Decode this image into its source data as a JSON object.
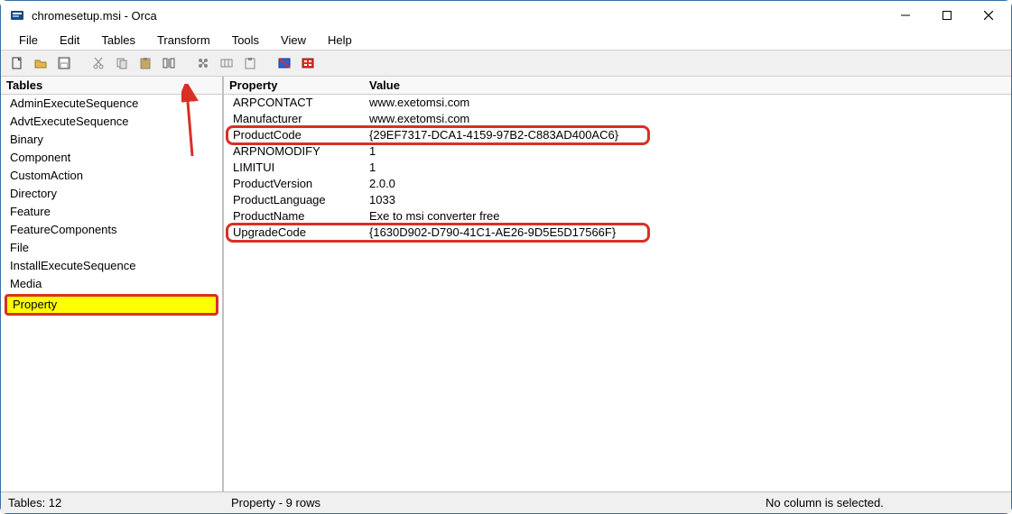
{
  "window": {
    "title": "chromesetup.msi - Orca"
  },
  "menu": {
    "items": [
      "File",
      "Edit",
      "Tables",
      "Transform",
      "Tools",
      "View",
      "Help"
    ]
  },
  "left": {
    "header": "Tables",
    "items": [
      "AdminExecuteSequence",
      "AdvtExecuteSequence",
      "Binary",
      "Component",
      "CustomAction",
      "Directory",
      "Feature",
      "FeatureComponents",
      "File",
      "InstallExecuteSequence",
      "Media",
      "Property"
    ],
    "selected": "Property"
  },
  "grid": {
    "columns": {
      "property": "Property",
      "value": "Value"
    },
    "rows": [
      {
        "property": "ARPCONTACT",
        "value": "www.exetomsi.com"
      },
      {
        "property": "Manufacturer",
        "value": "www.exetomsi.com"
      },
      {
        "property": "ProductCode",
        "value": "{29EF7317-DCA1-4159-97B2-C883AD400AC6}"
      },
      {
        "property": "ARPNOMODIFY",
        "value": "1"
      },
      {
        "property": "LIMITUI",
        "value": "1"
      },
      {
        "property": "ProductVersion",
        "value": "2.0.0"
      },
      {
        "property": "ProductLanguage",
        "value": "1033"
      },
      {
        "property": "ProductName",
        "value": "Exe to msi converter free"
      },
      {
        "property": "UpgradeCode",
        "value": "{1630D902-D790-41C1-AE26-9D5E5D17566F}"
      }
    ]
  },
  "statusbar": {
    "left": "Tables: 12",
    "mid": "Property - 9 rows",
    "right": "No column is selected."
  },
  "annotations": {
    "highlighted_rows": [
      "ProductCode",
      "UpgradeCode"
    ],
    "arrow_target": "toolbar-guid-button",
    "colors": {
      "highlight_border": "#d93025",
      "selected_bg": "#ffff00"
    }
  }
}
